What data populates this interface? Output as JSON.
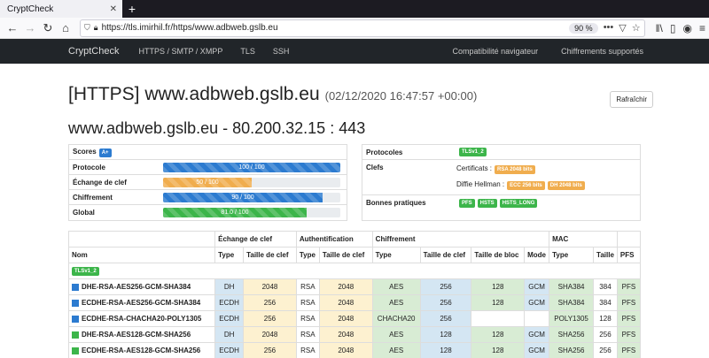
{
  "browser": {
    "tab_title": "CryptCheck",
    "url": "https://tls.imirhil.fr/https/www.adbweb.gslb.eu",
    "zoom": "90 %"
  },
  "nav": {
    "brand": "CryptCheck",
    "links": [
      "HTTPS / SMTP / XMPP",
      "TLS",
      "SSH"
    ],
    "right_links": [
      "Compatibilité navigateur",
      "Chiffrements supportés"
    ]
  },
  "page": {
    "refresh_label": "Rafraîchir",
    "title": "[HTTPS] www.adbweb.gslb.eu",
    "date": "(02/12/2020 16:47:57 +00:00)",
    "host": "www.adbweb.gslb.eu - 80.200.32.15 : 443"
  },
  "scores": {
    "label": "Scores",
    "grade": "A+",
    "rows": [
      {
        "label": "Protocole",
        "text": "100 / 100",
        "value": 100,
        "color": "blue"
      },
      {
        "label": "Échange de clef",
        "text": "50 / 100",
        "value": 50,
        "color": "orange"
      },
      {
        "label": "Chiffrement",
        "text": "90 / 100",
        "value": 90,
        "color": "blue"
      },
      {
        "label": "Global",
        "text": "81.0 / 100",
        "value": 81,
        "color": "green"
      }
    ]
  },
  "details": {
    "protocols_label": "Protocoles",
    "protocol_badge": "TLSv1_2",
    "keys_label": "Clefs",
    "cert_label": "Certificats :",
    "cert_badge": "RSA 2048 bits",
    "dh_label": "Diffie Hellman :",
    "dh_badges": [
      "ECC 256 bits",
      "DH 2048 bits"
    ],
    "bp_label": "Bonnes pratiques",
    "bp_badges": [
      "PFS",
      "HSTS",
      "HSTS_LONG"
    ]
  },
  "table": {
    "groups": [
      "Échange de clef",
      "Authentification",
      "Chiffrement",
      "MAC"
    ],
    "headers": [
      "Nom",
      "Type",
      "Taille de clef",
      "Type",
      "Taille de clef",
      "Type",
      "Taille de clef",
      "Taille de bloc",
      "Mode",
      "Type",
      "Taille",
      "PFS"
    ],
    "section_badge": "TLSv1_2",
    "rows": [
      {
        "name": "DHE-RSA-AES256-GCM-SHA384",
        "kx": "DH",
        "kxs": "2048",
        "au": "RSA",
        "aus": "2048",
        "enc": "AES",
        "encs": "256",
        "blk": "128",
        "mode": "GCM",
        "mac": "SHA384",
        "macs": "384",
        "pfs": "PFS",
        "sq": "bl"
      },
      {
        "name": "ECDHE-RSA-AES256-GCM-SHA384",
        "kx": "ECDH",
        "kxs": "256",
        "au": "RSA",
        "aus": "2048",
        "enc": "AES",
        "encs": "256",
        "blk": "128",
        "mode": "GCM",
        "mac": "SHA384",
        "macs": "384",
        "pfs": "PFS",
        "sq": "bl"
      },
      {
        "name": "ECDHE-RSA-CHACHA20-POLY1305",
        "kx": "ECDH",
        "kxs": "256",
        "au": "RSA",
        "aus": "2048",
        "enc": "CHACHA20",
        "encs": "256",
        "blk": "",
        "mode": "",
        "mac": "POLY1305",
        "macs": "128",
        "pfs": "PFS",
        "sq": "bl"
      },
      {
        "name": "DHE-RSA-AES128-GCM-SHA256",
        "kx": "DH",
        "kxs": "2048",
        "au": "RSA",
        "aus": "2048",
        "enc": "AES",
        "encs": "128",
        "blk": "128",
        "mode": "GCM",
        "mac": "SHA256",
        "macs": "256",
        "pfs": "PFS",
        "sq": "gr"
      },
      {
        "name": "ECDHE-RSA-AES128-GCM-SHA256",
        "kx": "ECDH",
        "kxs": "256",
        "au": "RSA",
        "aus": "2048",
        "enc": "AES",
        "encs": "128",
        "blk": "128",
        "mode": "GCM",
        "mac": "SHA256",
        "macs": "256",
        "pfs": "PFS",
        "sq": "gr"
      }
    ]
  }
}
